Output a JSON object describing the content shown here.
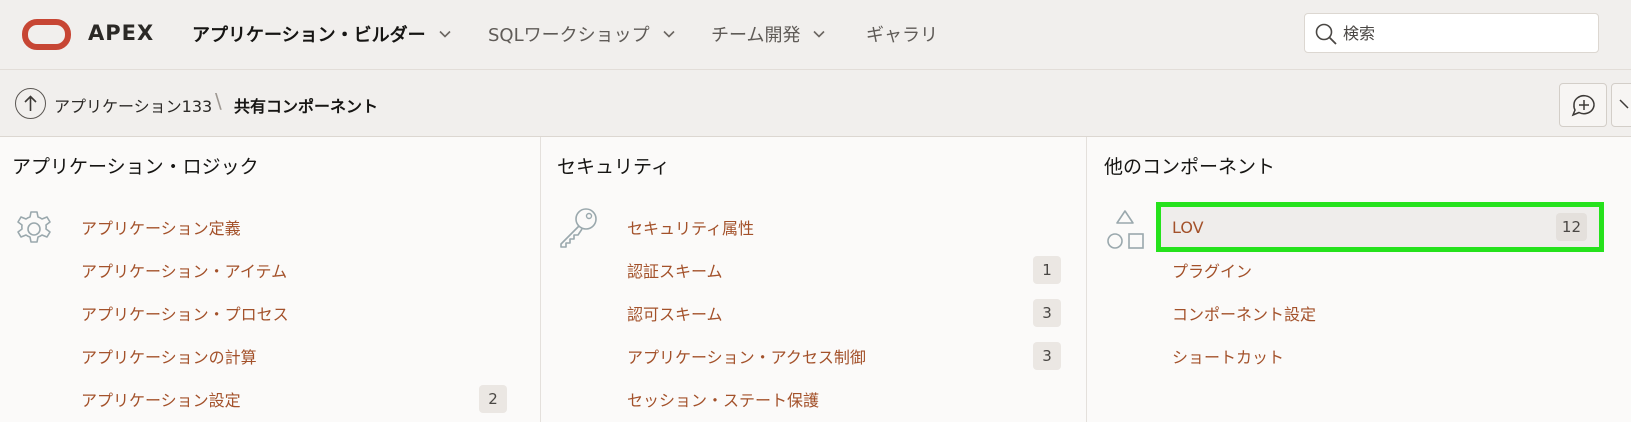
{
  "header": {
    "brand": "APEX",
    "nav": [
      {
        "label": "アプリケーション・ビルダー",
        "active": true
      },
      {
        "label": "SQLワークショップ"
      },
      {
        "label": "チーム開発"
      },
      {
        "label": "ギャラリ"
      }
    ],
    "search_placeholder": "検索"
  },
  "breadcrumb": {
    "parent": "アプリケーション133",
    "separator": "\\",
    "current": "共有コンポーネント"
  },
  "panels": {
    "logic": {
      "title": "アプリケーション・ロジック",
      "icon": "gear-icon",
      "items": [
        {
          "label": "アプリケーション定義"
        },
        {
          "label": "アプリケーション・アイテム"
        },
        {
          "label": "アプリケーション・プロセス"
        },
        {
          "label": "アプリケーションの計算"
        },
        {
          "label": "アプリケーション設定",
          "count": "2"
        }
      ]
    },
    "security": {
      "title": "セキュリティ",
      "icon": "key-icon",
      "items": [
        {
          "label": "セキュリティ属性"
        },
        {
          "label": "認証スキーム",
          "count": "1"
        },
        {
          "label": "認可スキーム",
          "count": "3"
        },
        {
          "label": "アプリケーション・アクセス制御",
          "count": "3"
        },
        {
          "label": "セッション・ステート保護"
        }
      ]
    },
    "other": {
      "title": "他のコンポーネント",
      "icon": "shapes-icon",
      "items": [
        {
          "label": "LOV",
          "count": "12",
          "highlighted": true
        },
        {
          "label": "プラグイン"
        },
        {
          "label": "コンポーネント設定"
        },
        {
          "label": "ショートカット"
        }
      ]
    }
  },
  "colors": {
    "link": "#a3512a",
    "brand_logo": "#c74634",
    "highlight_outline": "#25e21c"
  }
}
